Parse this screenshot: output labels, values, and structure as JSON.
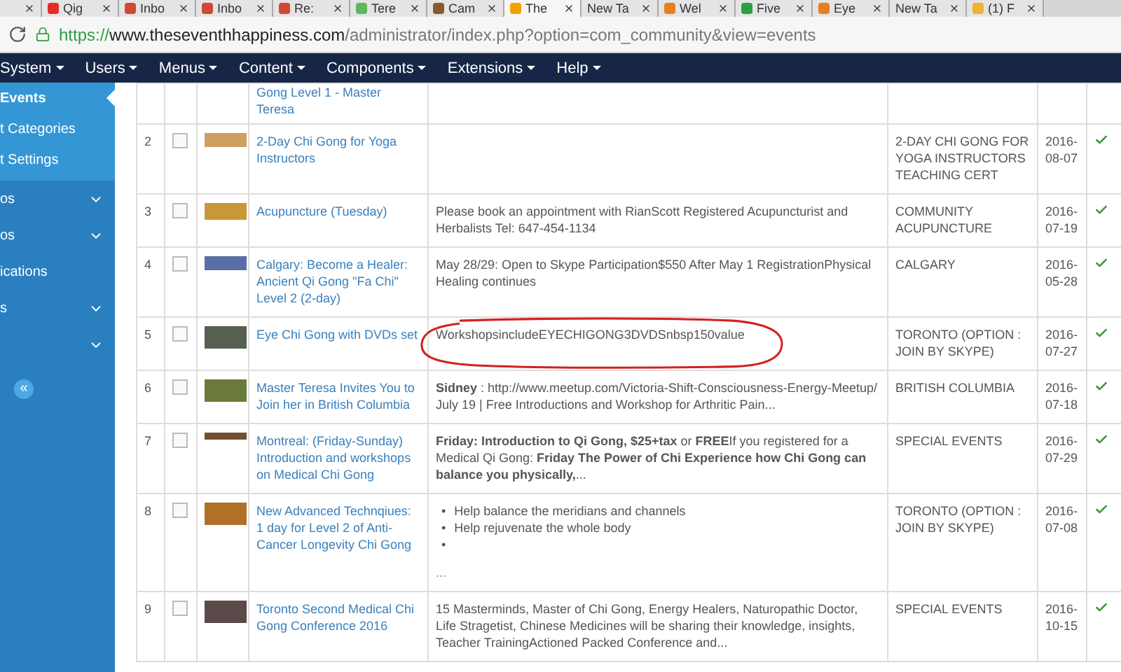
{
  "browser": {
    "tabs": [
      {
        "selected": false
      },
      {
        "label": "Qig",
        "color": "#e52d27",
        "selected": false
      },
      {
        "label": "Inbo",
        "color": "#d14836",
        "selected": false
      },
      {
        "label": "Inbo",
        "color": "#d14836",
        "selected": false
      },
      {
        "label": "Re:",
        "color": "#d14836",
        "selected": false
      },
      {
        "label": "Tere",
        "color": "#5cb85c",
        "selected": false
      },
      {
        "label": "Cam",
        "color": "#8b5a2b",
        "selected": false
      },
      {
        "label": "The",
        "color": "#f4a100",
        "selected": true
      },
      {
        "label": "New Ta",
        "selected": false
      },
      {
        "label": "Wel",
        "color": "#e87e22",
        "selected": false
      },
      {
        "label": "Five",
        "color": "#2e9e3e",
        "selected": false
      },
      {
        "label": "Eye",
        "color": "#e87e22",
        "selected": false
      },
      {
        "label": "New Ta",
        "selected": false
      },
      {
        "label": "(1) F",
        "color": "#f0b030",
        "selected": false
      }
    ],
    "url": {
      "scheme": "https://",
      "host": "www.theseventhhappiness.com",
      "path": "/administrator/index.php?option=com_community&view=events"
    }
  },
  "menu": [
    "System",
    "Users",
    "Menus",
    "Content",
    "Components",
    "Extensions",
    "Help"
  ],
  "sidebar": {
    "subitems": [
      {
        "label": "Events",
        "selected": true
      },
      {
        "label": "t Categories",
        "selected": false
      },
      {
        "label": "t Settings",
        "selected": false
      }
    ],
    "items": [
      {
        "label": "os",
        "expandable": true
      },
      {
        "label": "os",
        "expandable": true
      },
      {
        "label": "ications",
        "expandable": false
      },
      {
        "label": "s",
        "expandable": true
      },
      {
        "expandable": true
      }
    ],
    "collapse": "«"
  },
  "table": {
    "rows": [
      {
        "title": "Gong Level 1 - Master Teresa"
      },
      {
        "number": "2",
        "title": "2-Day Chi Gong for Yoga Instructors",
        "category": "2-DAY CHI GONG FOR YOGA INSTRUCTORS TEACHING CERT",
        "date": "2016-08-07",
        "checked": false,
        "published": true
      },
      {
        "number": "3",
        "title": "Acupuncture (Tuesday)",
        "description": {
          "kind": "text",
          "text": "Please book an appointment with RianScott Registered  Acupuncturist and Herbalists  Tel: 647-454-1134"
        },
        "category": "COMMUNITY ACUPUNCTURE",
        "date": "2016-07-19",
        "checked": false,
        "published": true
      },
      {
        "number": "4",
        "title": "Calgary: Become a Healer: Ancient Qi Gong \"Fa Chi\" Level 2 (2-day)",
        "description": {
          "kind": "text",
          "text": "May 28/29: Open to Skype Participation$550 After May 1 RegistrationPhysical Healing continues"
        },
        "category": "CALGARY",
        "date": "2016-05-28",
        "checked": false,
        "published": true
      },
      {
        "number": "5",
        "title": "Eye Chi Gong with DVDs set",
        "description": {
          "kind": "text",
          "text": "WorkshopsincludeEYECHIGONG3DVDSnbsp150value"
        },
        "category": "TORONTO (OPTION : JOIN BY SKYPE)",
        "date": "2016-07-27",
        "checked": false,
        "published": true,
        "annotated": true
      },
      {
        "number": "6",
        "title": "Master Teresa Invites You to Join her in British Columbia",
        "description": {
          "kind": "text",
          "text": "**Sidney** : http://www.meetup.com/Victoria-Shift-Consciousness-Energy-Meetup/ July 19 | Free Introductions and Workshop for Arthritic Pain..."
        },
        "category": "BRITISH COLUMBIA",
        "date": "2016-07-18",
        "checked": false,
        "published": true
      },
      {
        "number": "7",
        "title": "Montreal: (Friday-Sunday) Introduction and workshops on Medical Chi Gong",
        "description": {
          "kind": "text",
          "text": "**Friday: Introduction to Qi Gong, $25+tax** or **FREE**If you registered for a Medical Qi Gong:  **Friday The Power of Chi Experience how Chi Gong can balance you physically,**..."
        },
        "category": "SPECIAL EVENTS",
        "date": "2016-07-29",
        "checked": false,
        "published": true
      },
      {
        "number": "8",
        "title": "New Advanced Technqiues: 1 day for Level 2 of Anti-Cancer Longevity Chi Gong",
        "description": {
          "kind": "list",
          "bullet": "•",
          "items": [
            "Help balance the meridians and channels",
            "Help rejuvenate the whole body"
          ],
          "trailing_empty_bullet": true,
          "more": "..."
        },
        "category": "TORONTO (OPTION : JOIN BY SKYPE)",
        "date": "2016-07-08",
        "checked": false,
        "published": true
      },
      {
        "number": "9",
        "title": "Toronto Second Medical Chi Gong Conference 2016",
        "description": {
          "kind": "text",
          "text": "15 Masterminds, Master of Chi Gong, Energy Healers, Naturopathic Doctor, Life Stragetist, Chinese Medicines will be sharing their knowledge, insights, Teacher TrainingActioned Packed Conference and..."
        },
        "category": "SPECIAL EVENTS",
        "date": "2016-10-15",
        "checked": false,
        "published": true
      }
    ]
  }
}
